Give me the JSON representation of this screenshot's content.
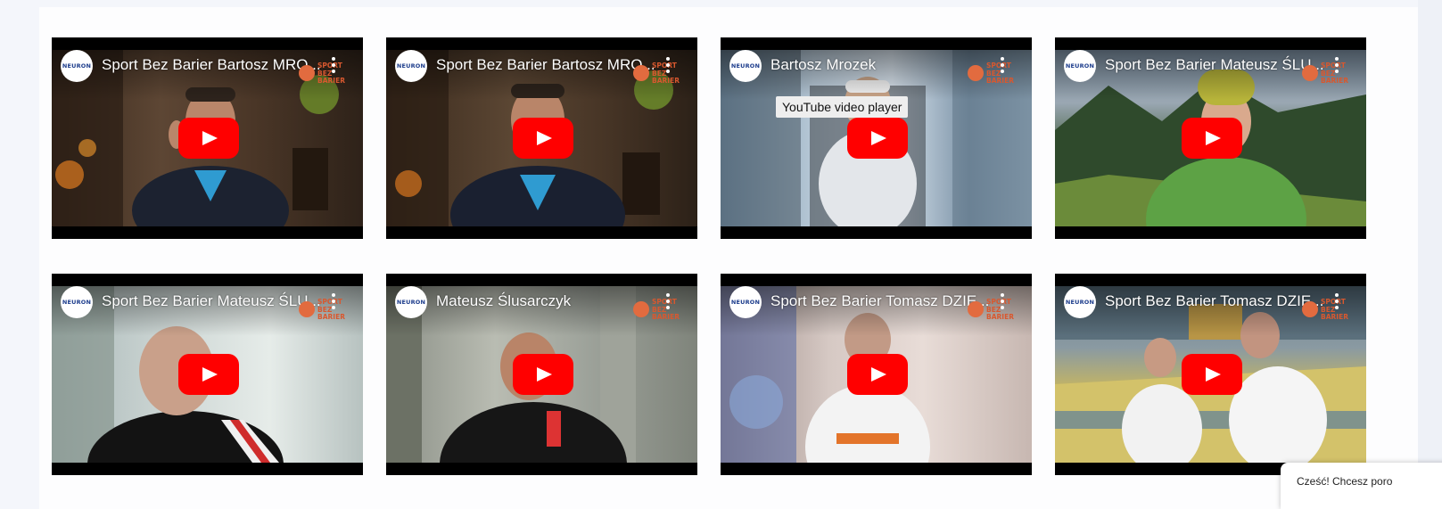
{
  "chat_popup": {
    "text": "Cześć! Chcesz poro"
  },
  "videos": [
    {
      "title": "Sport Bez Barier Bartosz MRO...",
      "channel": "NEURON",
      "logo": "SPORT BEZ BARIER"
    },
    {
      "title": "Sport Bez Barier Bartosz MRO...",
      "channel": "NEURON",
      "logo": "SPORT BEZ BARIER"
    },
    {
      "title": "Bartosz Mrozek",
      "channel": "NEURON",
      "logo": "SPORT BEZ BARIER",
      "tooltip": "YouTube video player"
    },
    {
      "title": "Sport Bez Barier Mateusz ŚLU...",
      "channel": "NEURON",
      "logo": "SPORT BEZ BARIER"
    },
    {
      "title": "Sport Bez Barier Mateusz ŚLU...",
      "channel": "NEURON",
      "logo": "SPORT BEZ BARIER"
    },
    {
      "title": "Mateusz Ślusarczyk",
      "channel": "NEURON",
      "logo": "SPORT BEZ BARIER"
    },
    {
      "title": "Sport Bez Barier Tomasz DZIE...",
      "channel": "NEURON",
      "logo": "SPORT BEZ BARIER"
    },
    {
      "title": "Sport Bez Barier Tomasz DZIE...",
      "channel": "NEURON",
      "logo": "SPORT BEZ BARIER"
    }
  ]
}
